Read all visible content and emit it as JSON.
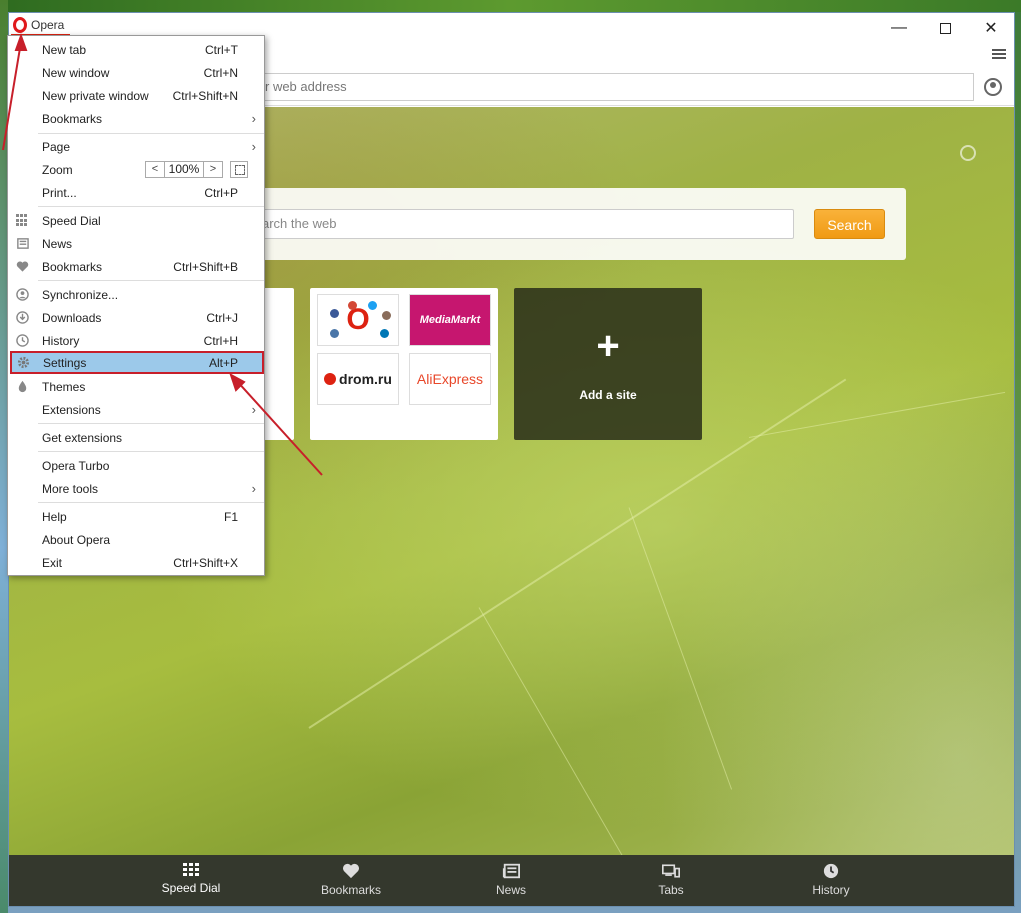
{
  "window": {
    "app_name": "Opera"
  },
  "toolbar": {
    "address_placeholder": "r web address"
  },
  "content": {
    "search_placeholder": "arch the web",
    "search_button": "Search",
    "add_site_plus": "+",
    "add_site_label": "Add a site",
    "tiles": {
      "social_letter": "O",
      "mediamarkt": "MediaMarkt",
      "drom": "drom.ru",
      "aliexpress": "AliExpress"
    }
  },
  "bottombar": {
    "items": [
      {
        "label": "Speed Dial",
        "icon": "grid-icon"
      },
      {
        "label": "Bookmarks",
        "icon": "heart-icon"
      },
      {
        "label": "News",
        "icon": "news-icon"
      },
      {
        "label": "Tabs",
        "icon": "tabs-icon"
      },
      {
        "label": "History",
        "icon": "clock-icon"
      }
    ]
  },
  "menu": {
    "items": [
      {
        "label": "New tab",
        "shortcut": "Ctrl+T"
      },
      {
        "label": "New window",
        "shortcut": "Ctrl+N"
      },
      {
        "label": "New private window",
        "shortcut": "Ctrl+Shift+N"
      },
      {
        "label": "Bookmarks",
        "shortcut": ""
      },
      {
        "label": "Page",
        "shortcut": ""
      },
      {
        "label": "Zoom",
        "shortcut": ""
      },
      {
        "label": "Print...",
        "shortcut": "Ctrl+P"
      },
      {
        "label": "Speed Dial",
        "shortcut": ""
      },
      {
        "label": "News",
        "shortcut": ""
      },
      {
        "label": "Bookmarks",
        "shortcut": "Ctrl+Shift+B"
      },
      {
        "label": "Synchronize...",
        "shortcut": ""
      },
      {
        "label": "Downloads",
        "shortcut": "Ctrl+J"
      },
      {
        "label": "History",
        "shortcut": "Ctrl+H"
      },
      {
        "label": "Settings",
        "shortcut": "Alt+P"
      },
      {
        "label": "Themes",
        "shortcut": ""
      },
      {
        "label": "Extensions",
        "shortcut": ""
      },
      {
        "label": "Get extensions",
        "shortcut": ""
      },
      {
        "label": "Opera Turbo",
        "shortcut": ""
      },
      {
        "label": "More tools",
        "shortcut": ""
      },
      {
        "label": "Help",
        "shortcut": "F1"
      },
      {
        "label": "About Opera",
        "shortcut": ""
      },
      {
        "label": "Exit",
        "shortcut": "Ctrl+Shift+X"
      }
    ],
    "zoom": {
      "decrease": "<",
      "value": "100%",
      "increase": ">"
    },
    "submenu_arrow": "›"
  },
  "colors": {
    "highlight": "#9cc9ea",
    "annotation_red": "#c71f2a",
    "search_button": "#f3a11f"
  }
}
